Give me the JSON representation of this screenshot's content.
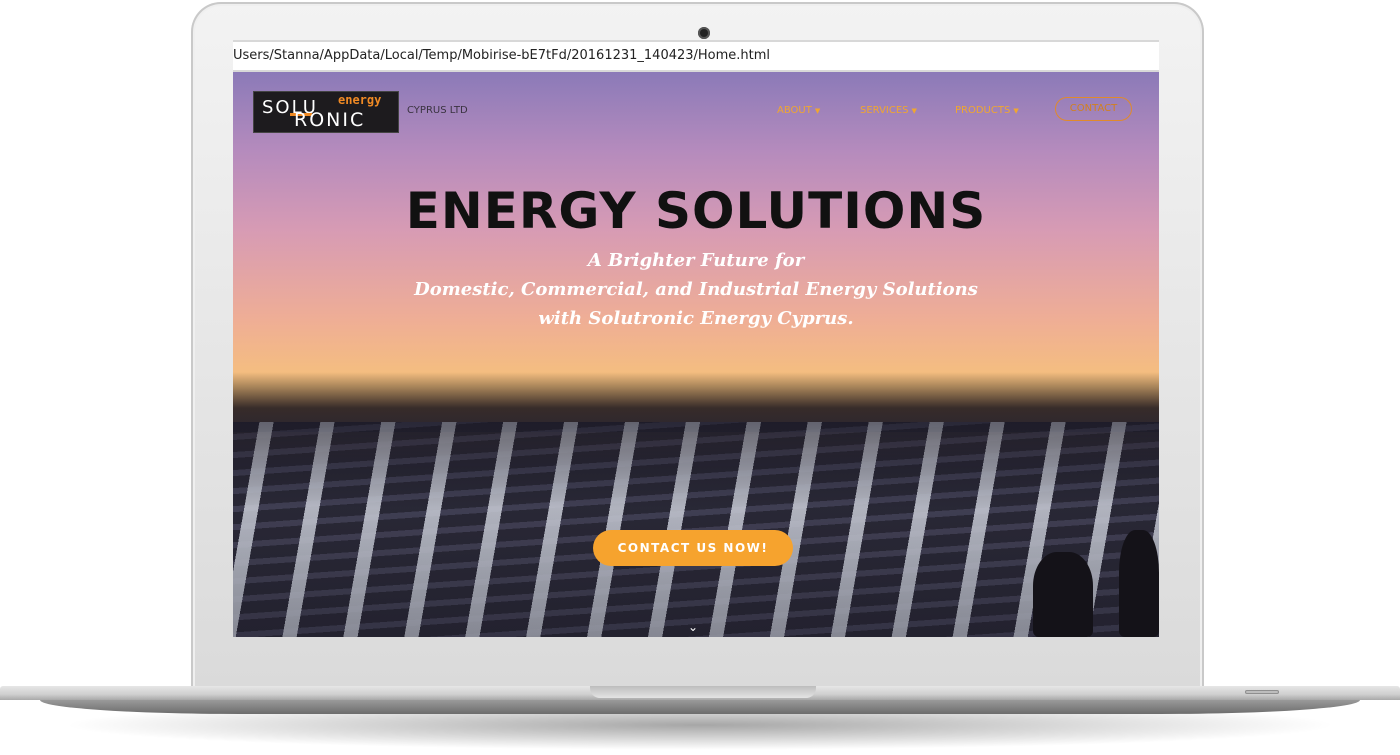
{
  "browser": {
    "address": "Users/Stanna/AppData/Local/Temp/Mobirise-bE7tFd/20161231_140423/Home.html"
  },
  "logo": {
    "line1": "SOLU",
    "line2": "RONIC",
    "tag": "energy"
  },
  "header": {
    "company": "CYPRUS LTD"
  },
  "nav": {
    "items": [
      {
        "label": "ABOUT",
        "caret": "▼"
      },
      {
        "label": "SERVICES",
        "caret": "▼"
      },
      {
        "label": "PRODUCTS",
        "caret": "▼"
      }
    ],
    "contact_label": "CONTACT"
  },
  "hero": {
    "title": "ENERGY SOLUTIONS",
    "lines": [
      "A Brighter Future for",
      "Domestic, Commercial, and Industrial Energy Solutions",
      "with Solutronic Energy Cyprus."
    ],
    "cta_label": "CONTACT US NOW!",
    "scroll_icon": "⌄"
  },
  "colors": {
    "accent": "#f6a32e",
    "nav_text": "#f0a630",
    "headline": "#111111"
  },
  "icons": {
    "camera": "webcam-icon",
    "scroll": "chevron-down-icon"
  }
}
